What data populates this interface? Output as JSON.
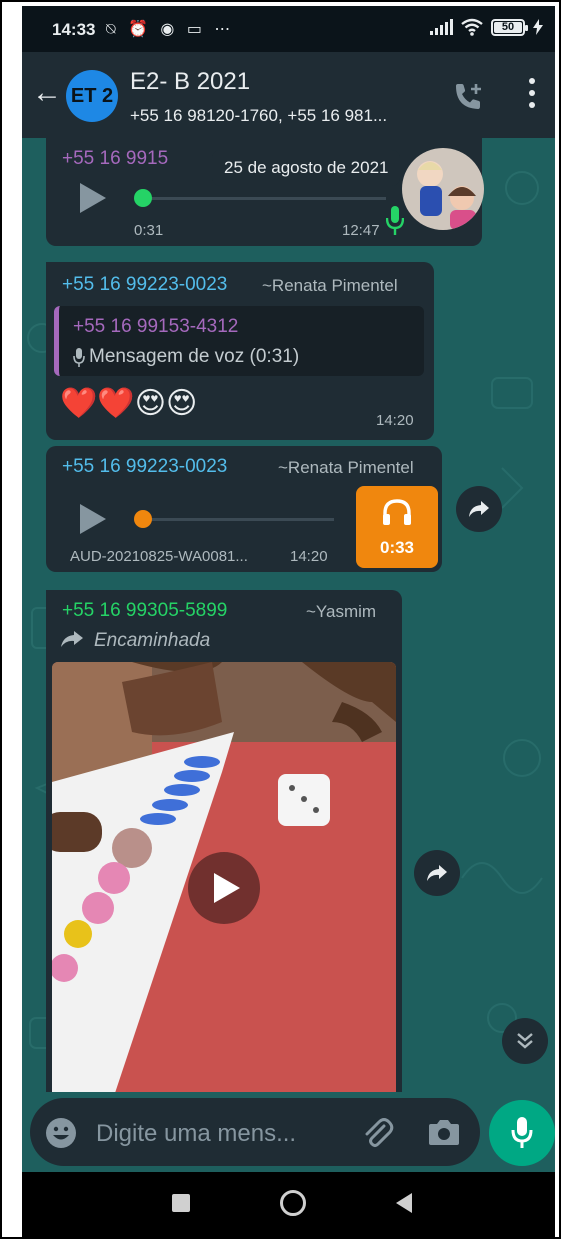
{
  "status_bar": {
    "time": "14:33",
    "icons_left": "⍉ ⏰ ◉ ▭ ⋯",
    "battery": "50"
  },
  "header": {
    "back_icon": "arrow-left-icon",
    "avatar_text": "ET 2",
    "title": "E2- B 2021",
    "subtitle": "+55 16 98120-1760, +55 16 981..."
  },
  "date_chip": "25 de agosto de 2021",
  "messages": [
    {
      "sender": "+55 16 9915",
      "elapsed": "0:31",
      "time": "12:47"
    },
    {
      "sender": "+55 16 99223-0023",
      "alias": "~Renata Pimentel",
      "quote_sender": "+55 16 99153-4312",
      "quote_text": "Mensagem de voz (0:31)",
      "emojis": "❤️❤️😍😍",
      "time": "14:20"
    },
    {
      "sender": "+55 16 99223-0023",
      "alias": "~Renata Pimentel",
      "filename": "AUD-20210825-WA0081...",
      "time": "14:20",
      "duration": "0:33"
    },
    {
      "sender": "+55 16 99305-5899",
      "alias": "~Yasmim",
      "forwarded": "Encaminhada"
    }
  ],
  "input": {
    "placeholder": "Digite uma mens..."
  },
  "colors": {
    "accent": "#00a884",
    "chat_bg": "#1e5f5e",
    "bubble": "#1f2c34",
    "sender_blue": "#53bdeb",
    "quote_purple": "#a569bd",
    "audio_orange": "#f0870e",
    "voice_green": "#25d366"
  }
}
